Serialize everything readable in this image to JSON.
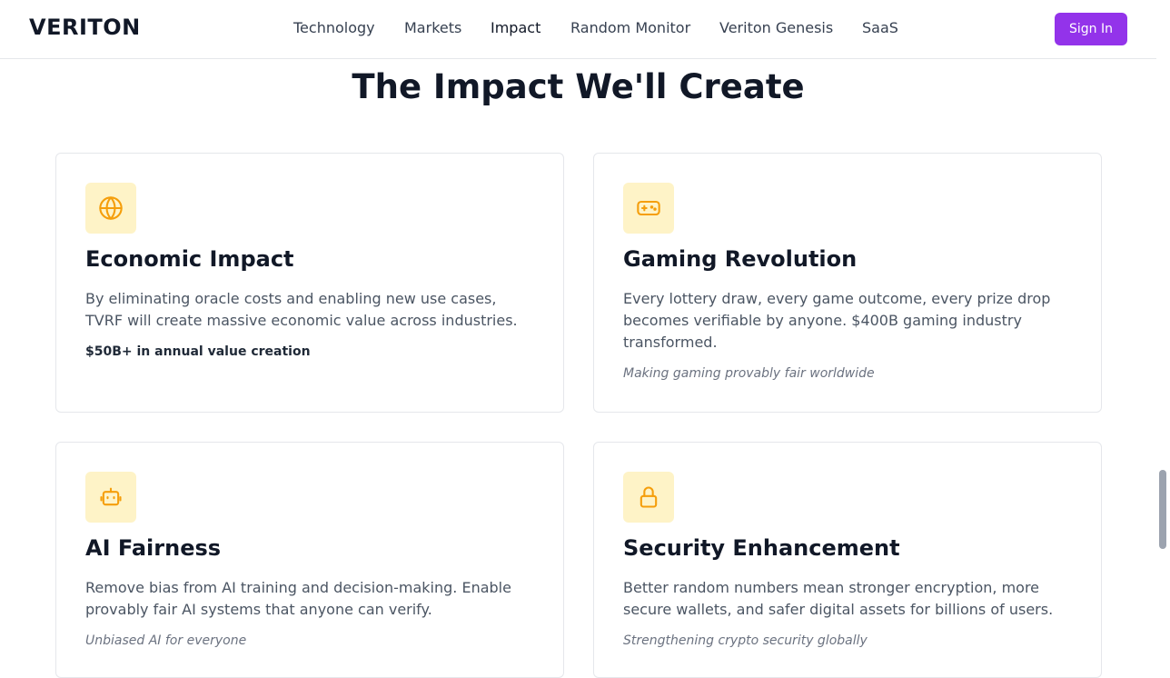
{
  "brand": {
    "name": "VERITON"
  },
  "nav": {
    "items": [
      {
        "label": "Technology"
      },
      {
        "label": "Markets"
      },
      {
        "label": "Impact"
      },
      {
        "label": "Random Monitor"
      },
      {
        "label": "Veriton Genesis"
      },
      {
        "label": "SaaS"
      }
    ],
    "active": "Impact",
    "sign_in_label": "Sign In"
  },
  "section": {
    "title": "The Impact We'll Create"
  },
  "cards": [
    {
      "icon": "globe-icon",
      "title": "Economic Impact",
      "description": "By eliminating oracle costs and enabling new use cases, TVRF will create massive economic value across industries.",
      "note": "$50B+ in annual value creation"
    },
    {
      "icon": "gamepad-icon",
      "title": "Gaming Revolution",
      "description": "Every lottery draw, every game outcome, every prize drop becomes verifiable by anyone. $400B gaming industry transformed.",
      "note": "Making gaming provably fair worldwide"
    },
    {
      "icon": "robot-icon",
      "title": "AI Fairness",
      "description": "Remove bias from AI training and decision-making. Enable provably fair AI systems that anyone can verify.",
      "note": "Unbiased AI for everyone"
    },
    {
      "icon": "lock-icon",
      "title": "Security Enhancement",
      "description": "Better random numbers mean stronger encryption, more secure wallets, and safer digital assets for billions of users.",
      "note": "Strengthening crypto security globally"
    }
  ],
  "colors": {
    "accent": "#9333ea",
    "icon_bg": "#fef3c7",
    "icon_stroke": "#f59e0b"
  }
}
